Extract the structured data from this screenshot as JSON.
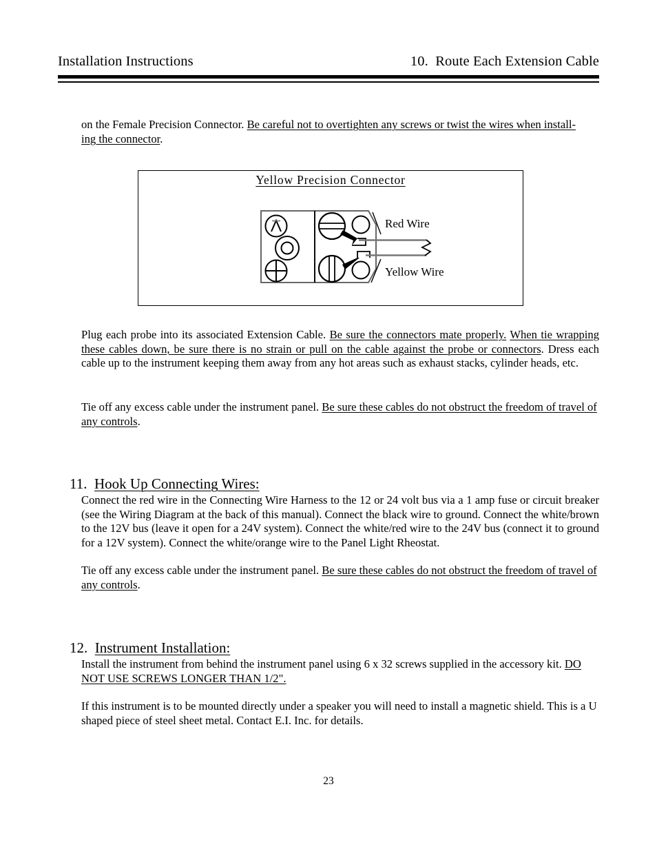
{
  "header": {
    "left": "Installation Instructions",
    "right": "10.  Route Each Extension Cable"
  },
  "paragraphs": {
    "intro_plain": "on the Female Precision Connector.  ",
    "intro_underlined_a": "Be careful not to overtighten any screws or twist the wires when install-",
    "intro_underlined_b": "ing the connector",
    "intro_tail": ".",
    "probe_plain_a": "Plug each probe into its associated Extension Cable.  ",
    "probe_underlined_a": "Be sure the connectors mate properly.",
    "probe_gap": "  ",
    "probe_underlined_b": "When tie wrapping these cables down, be sure there is no strain or pull on the cable against the probe or connectors",
    "probe_plain_b": ".  Dress each cable up to the instrument keeping them away from any hot areas such as exhaust stacks, cylinder heads, etc.",
    "tieoff_plain": "Tie off any excess cable under the instrument panel.  ",
    "tieoff_underlined": "Be sure these cables do not obstruct the freedom of travel of any controls",
    "tieoff_tail": ".",
    "hookup_body": "Connect the red wire in the Connecting Wire Harness to the 12 or 24 volt bus via a 1 amp fuse or circuit breaker (see the Wiring Diagram at the back of this manual).  Connect the black wire to ground.  Connect the white/brown to the 12V bus (leave it open for a 24V system).  Connect the white/red wire to the 24V bus (connect it to ground for a 12V system).  Connect the white/orange wire to the Panel Light Rheostat.",
    "install_plain": "Install the instrument from behind the instrument panel using 6 x 32 screws supplied in the accessory kit.  ",
    "install_underlined": "DO NOT USE SCREWS LONGER THAN 1/2\".",
    "shield_body": "If this instrument is to be mounted directly under a speaker you will need to install a magnetic shield.   This is a U shaped piece of steel sheet metal.  Contact E.I. Inc. for details."
  },
  "sections": [
    {
      "number": "11.",
      "title": "Hook Up Connecting Wires:"
    },
    {
      "number": "12.",
      "title": "Instrument Installation:"
    }
  ],
  "figure": {
    "title": "Yellow Precision Connector",
    "label_red": "Red Wire",
    "label_yellow": "Yellow Wire"
  },
  "page_number": "23",
  "colors": {
    "ink": "#000000",
    "paper": "#ffffff",
    "line_gray": "#555555"
  }
}
